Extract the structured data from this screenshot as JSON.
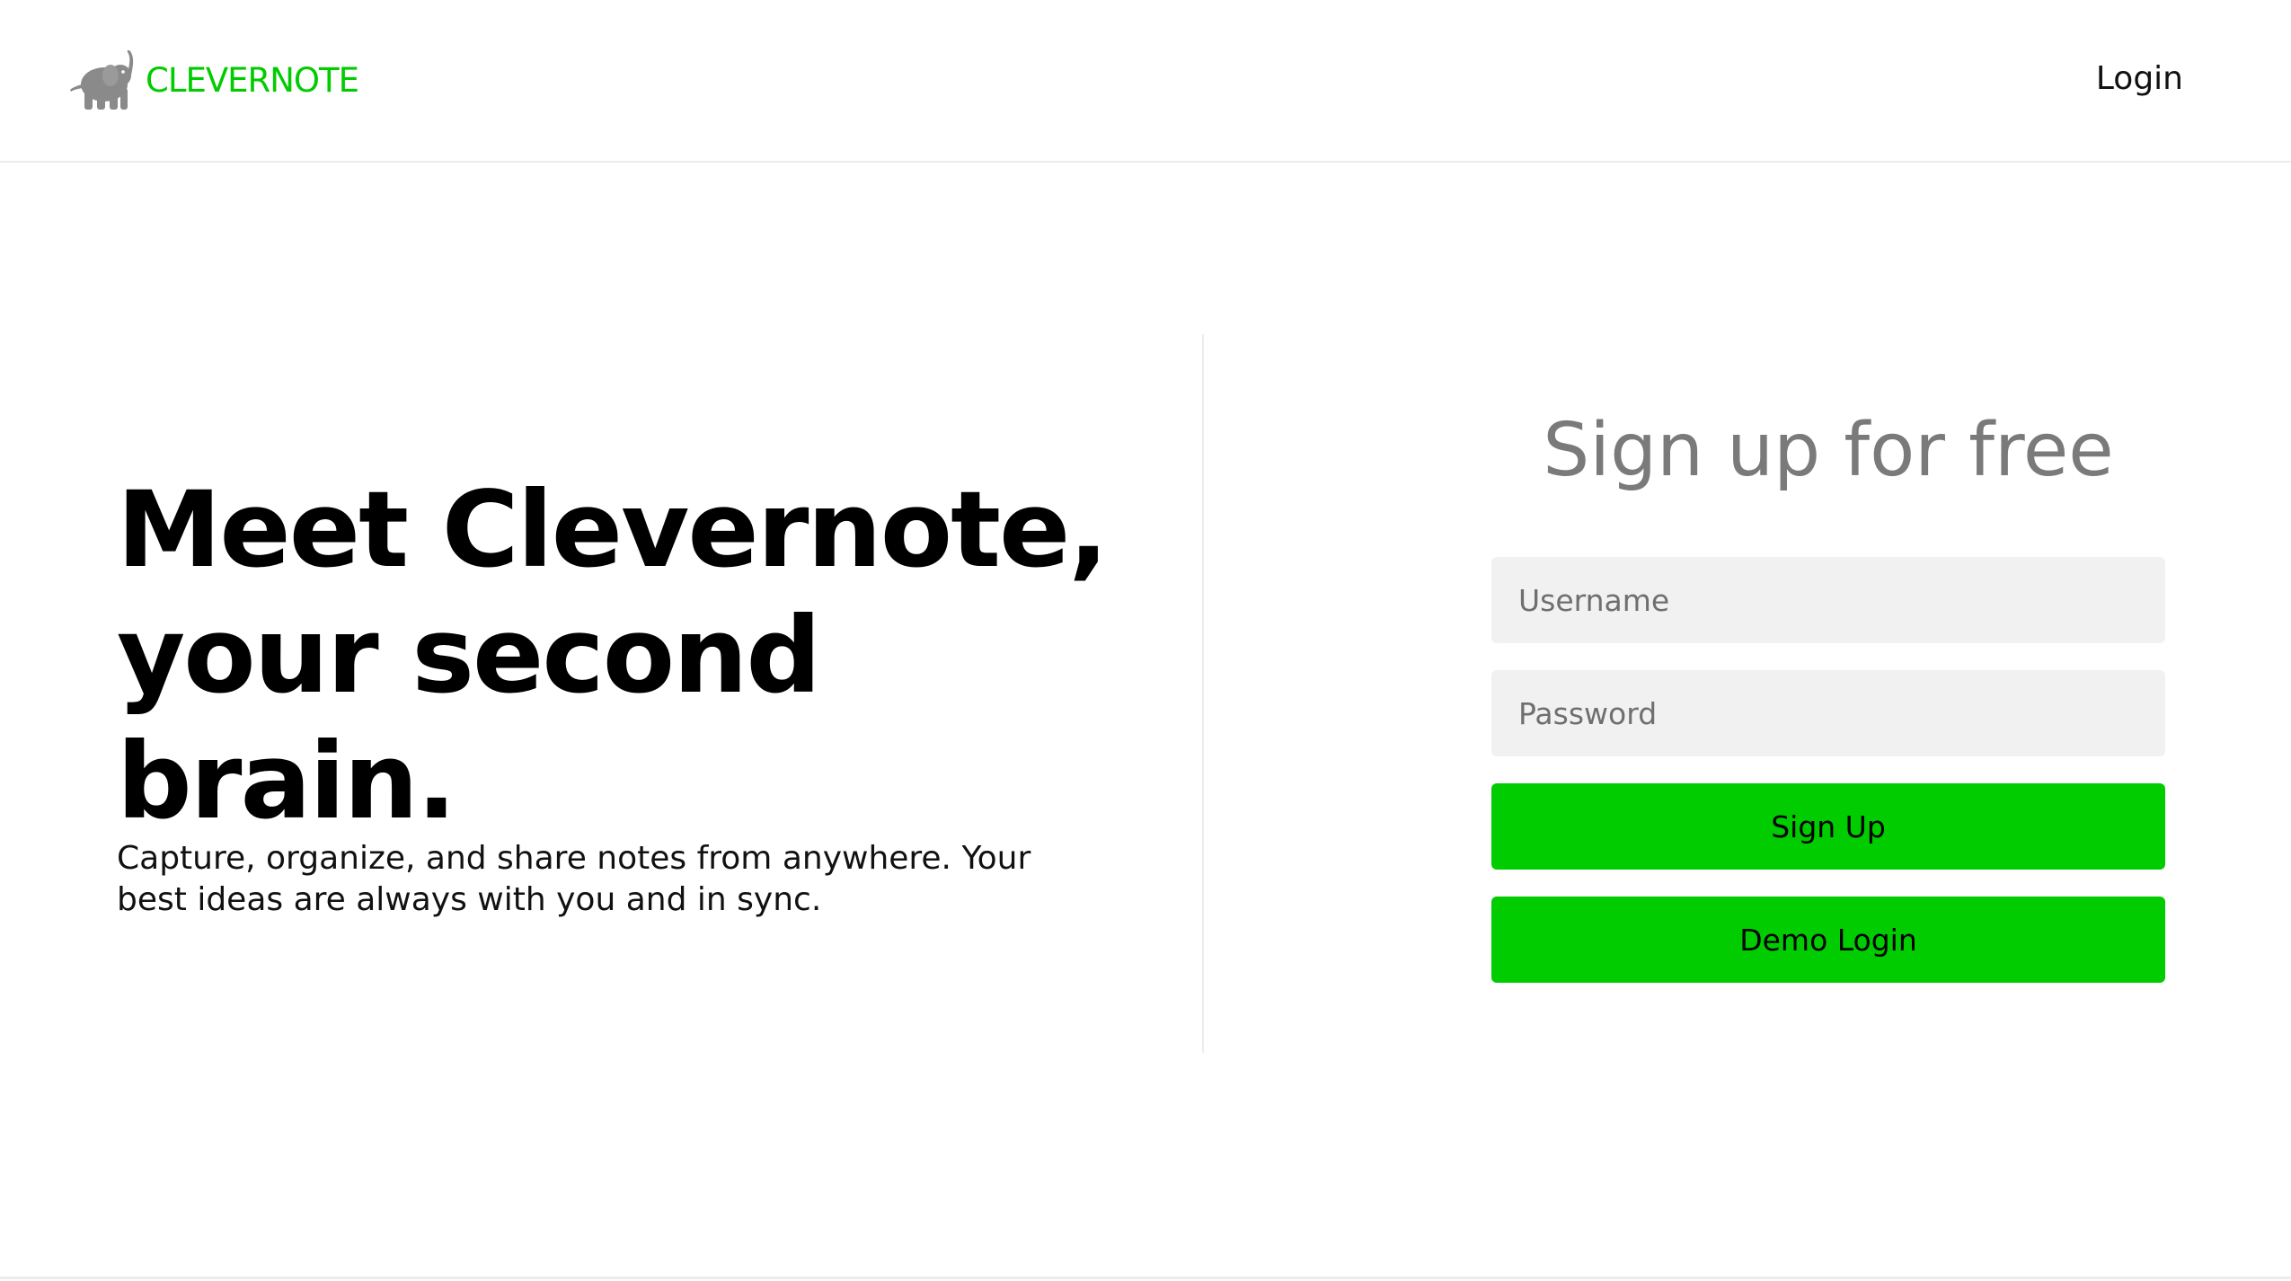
{
  "header": {
    "brand_name": "CLEVERNOTE",
    "logo_icon": "elephant-icon",
    "login_label": "Login"
  },
  "hero": {
    "title": "Meet Clevernote, your second brain.",
    "subtitle": "Capture, organize, and share notes from anywhere. Your best ideas are always with you and in sync."
  },
  "signup": {
    "title": "Sign up for free",
    "username_placeholder": "Username",
    "password_placeholder": "Password",
    "signup_button": "Sign Up",
    "demo_button": "Demo Login"
  },
  "colors": {
    "brand": "#00cc00",
    "button": "#00cc00",
    "input_bg": "#f1f1f1",
    "heading_gray": "#7a7a7a",
    "logo_gray": "#8a8a8a"
  }
}
